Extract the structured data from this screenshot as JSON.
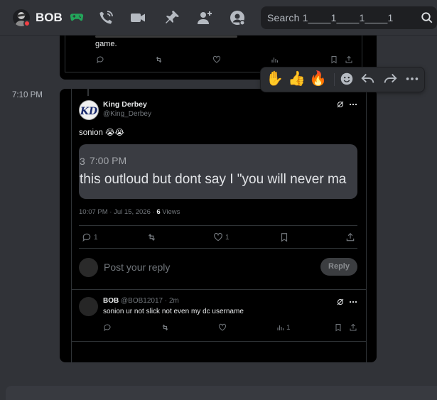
{
  "header": {
    "server_name": "BOB",
    "search_placeholder": "Search 1____1____1____1"
  },
  "top_embed": {
    "text_fragment": "game.",
    "actions": {
      "replies": "",
      "reposts": "",
      "likes": "",
      "views": ""
    }
  },
  "message": {
    "timestamp": "7:10 PM"
  },
  "tweet": {
    "author_name": "King Derbey",
    "author_handle": "@King_Derbey",
    "avatar_initials": "KD",
    "text": "sonion 😭😭",
    "media": {
      "time_label": "7:00 PM",
      "text": "this outloud but dont say I \"you will never ma"
    },
    "posted_at": "10:07 PM · Jul 15, 2026 · ",
    "views_count": "6",
    "views_label": " Views",
    "actions": {
      "replies": "1",
      "reposts": "",
      "likes": "1"
    },
    "reply_placeholder": "Post your reply",
    "reply_button": "Reply"
  },
  "reply": {
    "author_name": "BOB",
    "author_meta": " @BOB12017 · 2m",
    "text": "sonion ur not slick not even my dc username",
    "actions": {
      "replies": "",
      "reposts": "",
      "likes": "",
      "views": "1"
    }
  },
  "reactions": [
    "✋",
    "👍",
    "🔥"
  ],
  "colors": {
    "background": "#313338",
    "card": "#000000",
    "status_dnd": "#f23f43",
    "controller_green": "#23a55a"
  }
}
